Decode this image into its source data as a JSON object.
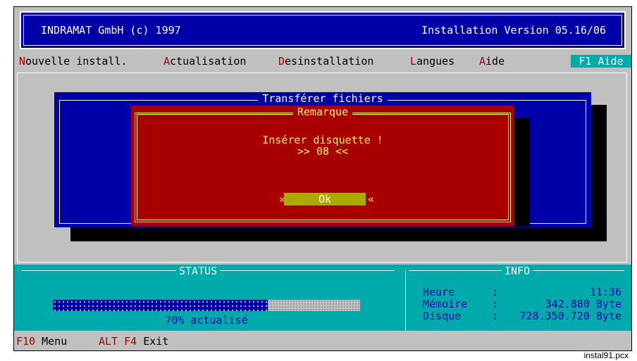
{
  "titlebar": {
    "left": "INDRAMAT GmbH (c) 1997",
    "right": "Installation Version 05.16/06"
  },
  "menu": {
    "items": [
      {
        "hot": "N",
        "rest": "ouvelle install."
      },
      {
        "hot": "A",
        "rest": "ctualisation"
      },
      {
        "hot": "D",
        "rest": "esinstallation"
      },
      {
        "hot": "L",
        "rest": "angues"
      },
      {
        "hot": "A",
        "rest": "ide"
      }
    ],
    "help_hint": "F1 Aide"
  },
  "transfer_window": {
    "title": "Transférer fichiers"
  },
  "remark_dialog": {
    "title": "Remarque",
    "message": "Insérer disquette !",
    "disk": ">> 08 <<",
    "ok_left": "»",
    "ok_label": "Ok",
    "ok_right": "«"
  },
  "status": {
    "title": "STATUS",
    "progress_fraction": 0.7,
    "progress_text": "70% actualisé"
  },
  "info": {
    "title": "INFO",
    "rows": [
      {
        "label": "Heure",
        "sep": ":",
        "value": "11:36"
      },
      {
        "label": "Mémoire",
        "sep": ":",
        "value": "342.880 Byte"
      },
      {
        "label": "Disque",
        "sep": ":",
        "value": "728.350.720 Byte"
      }
    ]
  },
  "keys": [
    {
      "key": "F10",
      "label": "Menu"
    },
    {
      "key": "ALT F4",
      "label": "Exit"
    }
  ],
  "caption": "instal91.pcx",
  "colors": {
    "dos_blue": "#0000a8",
    "dos_red": "#a80000",
    "dos_cyan": "#00aaaa",
    "dos_yellow": "#ffff55",
    "dos_grey": "#c0c0c0"
  }
}
